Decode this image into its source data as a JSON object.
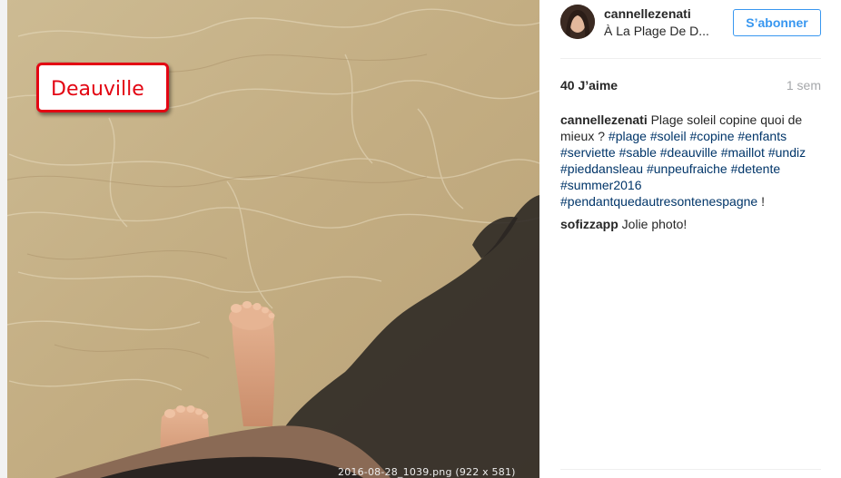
{
  "photo": {
    "overlay_label": "Deauville",
    "file_stamp": "2016-08-28_1039.png (922 x 581)"
  },
  "header": {
    "username": "cannellezenati",
    "location": "À La Plage De D...",
    "follow_label": "S’abonner"
  },
  "stats": {
    "likes": "40 J’aime",
    "time_ago": "1 sem"
  },
  "caption": {
    "author": "cannellezenati",
    "text": "Plage soleil copine quoi de mieux ?",
    "hashtags": [
      "#plage",
      "#soleil",
      "#copine",
      "#enfants",
      "#serviette",
      "#sable",
      "#deauville",
      "#maillot",
      "#undiz",
      "#pieddansleau",
      "#unpeufraiche",
      "#detente",
      "#summer2016",
      "#pendantquedautresontenespagne"
    ],
    "trailing": "!"
  },
  "comments": [
    {
      "author": "sofizzapp",
      "text": "Jolie photo!"
    }
  ],
  "colors": {
    "accent": "#3897f0",
    "hashtag": "#003569",
    "label_red": "#e30613"
  }
}
